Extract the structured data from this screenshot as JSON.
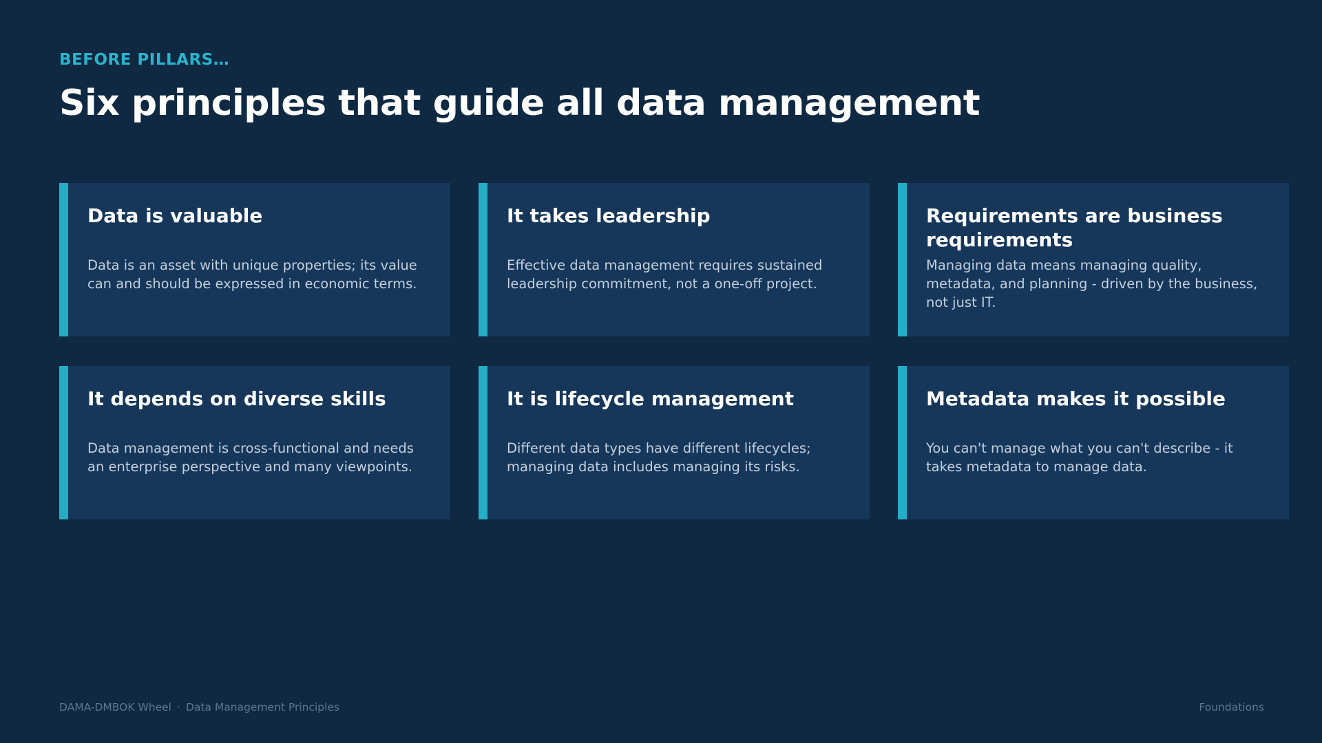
{
  "header": {
    "eyebrow": "BEFORE PILLARS…",
    "title": "Six principles that guide all data management"
  },
  "cards": [
    {
      "title": "Data is valuable",
      "body": "Data is an asset with unique properties; its value can and should be expressed in economic terms."
    },
    {
      "title": "It takes leadership",
      "body": "Effective data management requires sustained leadership commitment, not a one-off project."
    },
    {
      "title": "Requirements are business requirements",
      "body": "Managing data means managing quality, metadata, and planning - driven by the business, not just IT."
    },
    {
      "title": "It depends on diverse skills",
      "body": "Data management is cross-functional and needs an enterprise perspective and many viewpoints."
    },
    {
      "title": "It is lifecycle management",
      "body": "Different data types have different lifecycles; managing data includes managing its risks."
    },
    {
      "title": "Metadata makes it possible",
      "body": "You can't manage what you can't describe - it takes metadata to manage data."
    }
  ],
  "footer": {
    "left_primary": "DAMA-DMBOK Wheel",
    "separator": "·",
    "left_secondary": "Data Management Principles",
    "right": "Foundations"
  },
  "colors": {
    "background": "#0f2942",
    "card": "#16375a",
    "accent": "#23aec6",
    "eyebrow": "#2bb3cc"
  }
}
